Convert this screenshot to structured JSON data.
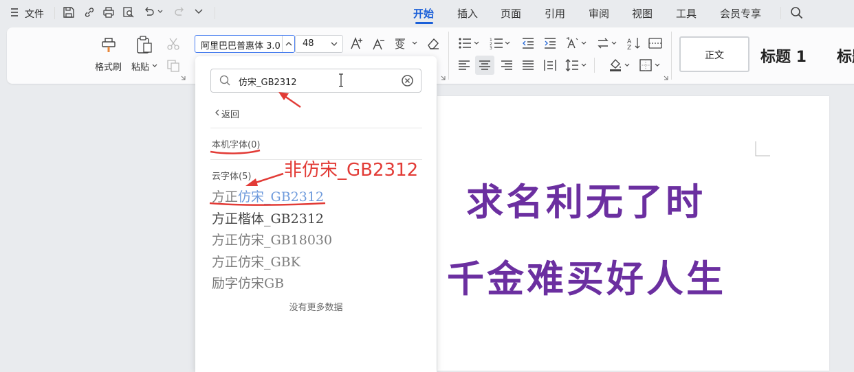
{
  "menubar": {
    "file_label": "文件",
    "tabs": [
      {
        "label": "开始",
        "active": true
      },
      {
        "label": "插入"
      },
      {
        "label": "页面"
      },
      {
        "label": "引用"
      },
      {
        "label": "审阅"
      },
      {
        "label": "视图"
      },
      {
        "label": "工具"
      },
      {
        "label": "会员专享"
      }
    ]
  },
  "ribbon": {
    "format_painter_label": "格式刷",
    "paste_label": "粘贴",
    "font_name_value": "阿里巴巴普惠体 3.0",
    "font_size_value": "48",
    "styles": [
      {
        "label": "正文"
      },
      {
        "label": "标题 1"
      },
      {
        "label": "标题"
      }
    ]
  },
  "font_panel": {
    "search_value": "仿宋_GB2312",
    "back_label": "返回",
    "local_fonts_header": "本机字体(0)",
    "cloud_fonts_header": "云字体(5)",
    "cloud_fonts": [
      {
        "prefix": "方正",
        "match": "仿宋_GB2312"
      },
      {
        "prefix": "方正楷体_GB2312",
        "match": ""
      },
      {
        "prefix": "方正仿宋_GB18030",
        "match": ""
      },
      {
        "prefix": "方正仿宋_GBK",
        "match": ""
      },
      {
        "prefix": "励字仿宋GB",
        "match": ""
      }
    ],
    "no_more_label": "没有更多数据"
  },
  "annotation": {
    "text": "非仿宋_GB2312"
  },
  "document": {
    "lines": [
      "求名利无了时",
      "千金难买好人生"
    ]
  },
  "colors": {
    "accent": "#1a5fd8",
    "document_text": "#6b2fa0",
    "annotation": "#e23b36"
  }
}
